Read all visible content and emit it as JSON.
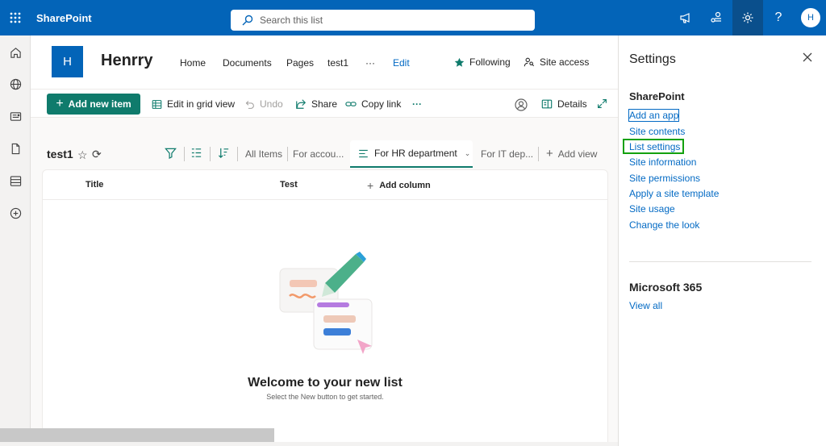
{
  "topbar": {
    "app_name": "SharePoint",
    "search_placeholder": "Search this list",
    "avatar_initial": "H",
    "color": "#0364b8"
  },
  "site": {
    "logo_letter": "H",
    "title": "Henrry",
    "nav": [
      "Home",
      "Documents",
      "Pages",
      "test1",
      "···",
      "Edit"
    ],
    "following_label": "Following",
    "site_access_label": "Site access"
  },
  "commands": {
    "add_new_item": "Add new item",
    "edit_grid": "Edit in grid view",
    "undo": "Undo",
    "share": "Share",
    "copy_link": "Copy link",
    "more": "···",
    "details": "Details"
  },
  "list": {
    "title": "test1",
    "views": {
      "all_items": "All Items",
      "for_accounting": "For accou...",
      "for_hr": "For HR department",
      "for_it": "For IT dep...",
      "add_view": "Add view"
    },
    "columns": {
      "title": "Title",
      "test": "Test",
      "add_column": "Add column"
    },
    "empty": {
      "title": "Welcome to your new list",
      "subtitle": "Select the New button to get started."
    }
  },
  "settings_panel": {
    "title": "Settings",
    "sharepoint_section": "SharePoint",
    "links": [
      "Add an app",
      "Site contents",
      "List settings",
      "Site information",
      "Site permissions",
      "Apply a site template",
      "Site usage",
      "Change the look"
    ],
    "m365_section": "Microsoft 365",
    "view_all": "View all"
  },
  "colors": {
    "accent": "#0f7b6c",
    "link": "#036ac4",
    "highlight": "#13a10e"
  }
}
